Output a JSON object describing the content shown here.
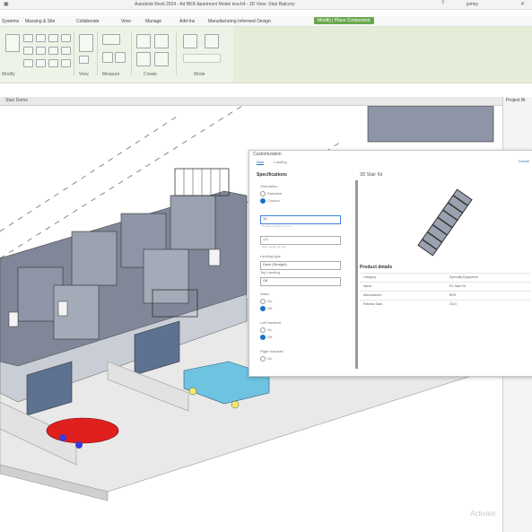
{
  "window": {
    "title": "Autodesk Revit 2024 - Ad BKR Apartment Model tesch4 - 3D View: Stair Balcony",
    "user": "jsmiry"
  },
  "ribbon_tabs": [
    "Systems",
    "Massing & Site",
    "Collaborate",
    "View",
    "Manage",
    "Add-Ins",
    "Manufacturing Informed Design",
    "Modify | Place Component"
  ],
  "ribbon_groups": {
    "g1": "Modify",
    "g2": "View",
    "g3": "Measure",
    "g4": "Create",
    "g5": "Mode"
  },
  "view_tab": {
    "label": "Stair Demo"
  },
  "project_browser": {
    "title": "Project Br"
  },
  "dialog": {
    "title": "Customization",
    "tabs": [
      "Stair",
      "Landing"
    ],
    "active_tab": "Stair",
    "cancel": "Cancel",
    "left": {
      "section": "Specifications",
      "run_direction_label": "Orientation",
      "opt1": "Standard",
      "opt2": "Custom",
      "field1_value": "10",
      "field1_hint": "Number of Risers per run",
      "field2_value": "1.0",
      "field2_hint": "Riser height per rise",
      "dropdown1_label": "Landing type",
      "dropdown1_value": "Deck (Straight)",
      "dropdown2_label": "Top Landing",
      "dropdown2_value": "Off",
      "stair_label": "Stairs",
      "stair_opt1": "On",
      "stair_opt2": "Off",
      "rail_label": "Left Handrail",
      "rail_opt1": "On",
      "rail_opt2": "Off",
      "right_label": "Right Handrail",
      "right_opt1": "On"
    },
    "right": {
      "heading": "3D Stair Kit",
      "product_details": "Product details",
      "rows": [
        {
          "k": "Category",
          "v": "Specialty Equipment"
        },
        {
          "k": "Name",
          "v": "R1 Stair Kit"
        },
        {
          "k": "Manufacturer",
          "v": "BKR"
        },
        {
          "k": "Release Date",
          "v": "2024"
        }
      ]
    }
  },
  "watermark": "Activate"
}
